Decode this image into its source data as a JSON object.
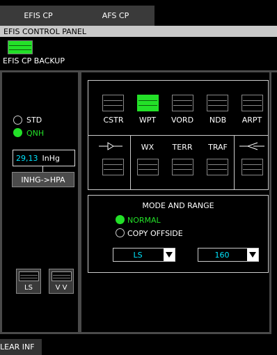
{
  "tabs": [
    {
      "label": "EFIS CP",
      "active": true
    },
    {
      "label": "AFS CP",
      "active": false
    }
  ],
  "panel_title": "EFIS CONTROL PANEL",
  "backup": {
    "label": "EFIS CP BACKUP",
    "state": "on"
  },
  "baro": {
    "std_label": "STD",
    "qnh_label": "QNH",
    "selected": "QNH",
    "value": "29,13",
    "unit": "InHg",
    "convert_label": "INHG->HPA"
  },
  "left_buttons": [
    {
      "label": "LS",
      "state": "off"
    },
    {
      "label": "V V",
      "state": "off"
    }
  ],
  "nd_filters": [
    {
      "label": "CSTR",
      "state": "off"
    },
    {
      "label": "WPT",
      "state": "on"
    },
    {
      "label": "VORD",
      "state": "off"
    },
    {
      "label": "NDB",
      "state": "off"
    },
    {
      "label": "ARPT",
      "state": "off"
    }
  ],
  "nav_buttons": [
    {
      "label": "—▷—",
      "icon": "vor-adf-1-icon"
    },
    {
      "label": "WX",
      "icon": ""
    },
    {
      "label": "TERR",
      "icon": ""
    },
    {
      "label": "TRAF",
      "icon": ""
    },
    {
      "label": "—◁—",
      "icon": "vor-adf-2-icon"
    }
  ],
  "mode_range": {
    "title": "MODE AND RANGE",
    "normal_label": "NORMAL",
    "copy_offside_label": "COPY OFFSIDE",
    "selected": "NORMAL",
    "mode_value": "LS",
    "range_value": "160"
  },
  "bottom_button": {
    "label": "LEAR INF"
  },
  "colors": {
    "active_green": "#23e028",
    "value_cyan": "#00e6ff",
    "frame_gray": "#4a4a4a"
  }
}
